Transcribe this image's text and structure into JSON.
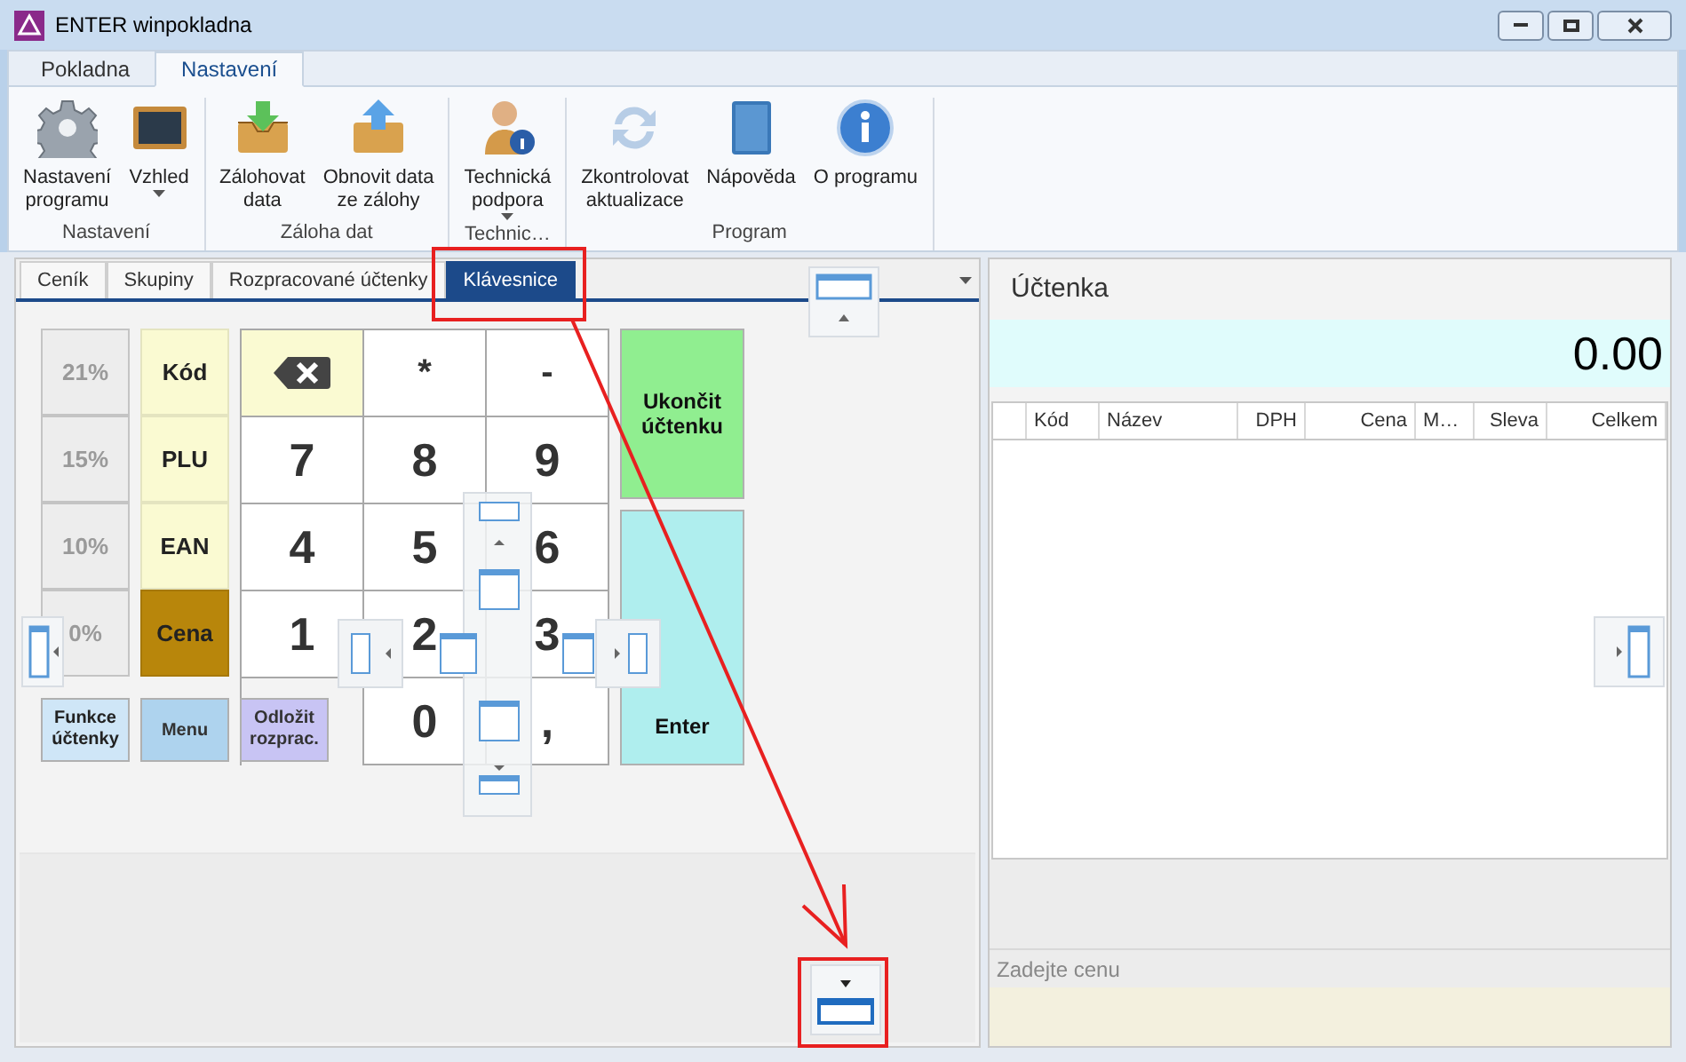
{
  "window": {
    "title": "ENTER winpokladna"
  },
  "ribbon": {
    "tabs": [
      {
        "label": "Pokladna",
        "selected": false
      },
      {
        "label": "Nastavení",
        "selected": true
      }
    ],
    "groups": [
      {
        "label": "Nastavení",
        "items": [
          {
            "label": "Nastavení\nprogramu",
            "dropdown": false
          },
          {
            "label": "Vzhled",
            "dropdown": true
          }
        ]
      },
      {
        "label": "Záloha dat",
        "items": [
          {
            "label": "Zálohovat\ndata",
            "dropdown": false
          },
          {
            "label": "Obnovit data\nze zálohy",
            "dropdown": false
          }
        ]
      },
      {
        "label": "Technic…",
        "items": [
          {
            "label": "Technická\npodpora",
            "dropdown": true
          }
        ]
      },
      {
        "label": "Program",
        "items": [
          {
            "label": "Zkontrolovat\naktualizace",
            "dropdown": false
          },
          {
            "label": "Nápověda",
            "dropdown": false
          },
          {
            "label": "O programu",
            "dropdown": false
          }
        ]
      }
    ]
  },
  "doc_tabs": [
    {
      "label": "Ceník",
      "selected": false
    },
    {
      "label": "Skupiny",
      "selected": false
    },
    {
      "label": "Rozpracované účtenky",
      "selected": false
    },
    {
      "label": "Klávesnice",
      "selected": true
    }
  ],
  "keypad": {
    "rate_keys": [
      {
        "label": "21%",
        "disabled": true
      },
      {
        "label": "15%",
        "disabled": true
      },
      {
        "label": "10%",
        "disabled": true
      },
      {
        "label": "0%",
        "disabled": true
      }
    ],
    "mode_keys": [
      {
        "label": "Kód",
        "selected": false
      },
      {
        "label": "PLU",
        "selected": false
      },
      {
        "label": "EAN",
        "selected": false
      },
      {
        "label": "Cena",
        "selected": true
      }
    ],
    "keys": [
      {
        "kind": "backspace"
      },
      {
        "kind": "key",
        "label": "*"
      },
      {
        "kind": "key",
        "label": "-"
      },
      {
        "kind": "key",
        "label": "7"
      },
      {
        "kind": "key",
        "label": "8"
      },
      {
        "kind": "key",
        "label": "9"
      },
      {
        "kind": "key",
        "label": "4"
      },
      {
        "kind": "key",
        "label": "5"
      },
      {
        "kind": "key",
        "label": "6"
      },
      {
        "kind": "key",
        "label": "1"
      },
      {
        "kind": "key",
        "label": "2"
      },
      {
        "kind": "key",
        "label": "3"
      },
      {
        "kind": "key",
        "label": "0"
      },
      {
        "kind": "key",
        "label": ","
      }
    ],
    "function_buttons": [
      {
        "label": "Funkce\núčtenky",
        "color": "#cfe6f7"
      },
      {
        "label": "Menu",
        "color": "#aed3ee"
      },
      {
        "label": "Odložit\nrozprac.",
        "color": "#c8c4f4"
      }
    ],
    "action_buttons": [
      {
        "label": "Ukončit\núčtenku",
        "color": "#90ee90"
      },
      {
        "label": "Enter",
        "color": "#afeeee"
      }
    ]
  },
  "receipt": {
    "title": "Účtenka",
    "total": "0.00",
    "columns": [
      "Kód",
      "Název",
      "DPH",
      "Cena",
      "M…",
      "Sleva",
      "Celkem"
    ],
    "input": {
      "placeholder": "Zadejte cenu"
    }
  }
}
